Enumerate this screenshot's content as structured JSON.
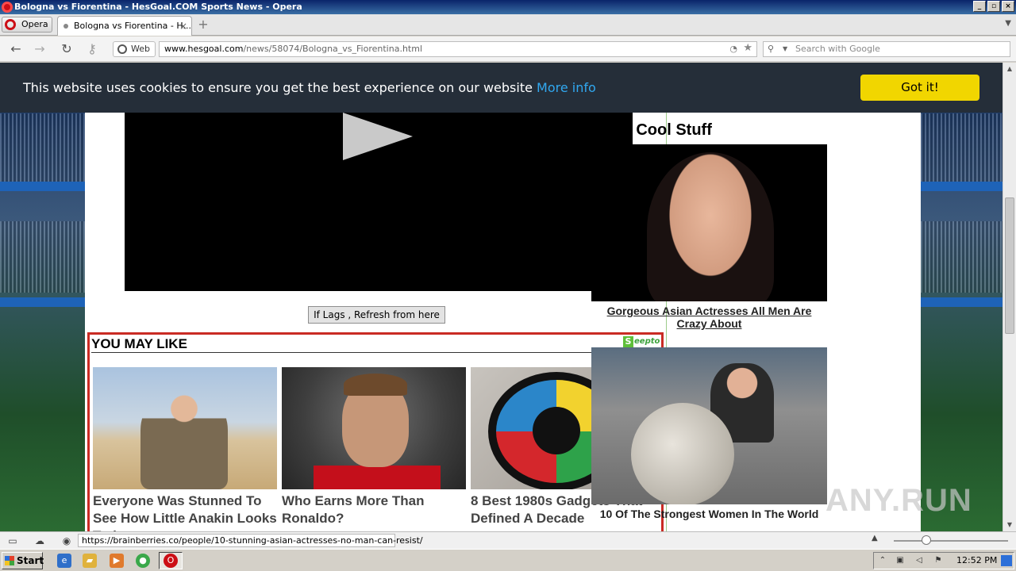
{
  "window": {
    "title": "Bologna vs Fiorentina - HesGoal.COM Sports News - Opera",
    "controls": [
      "_",
      "▫",
      "×"
    ]
  },
  "browser": {
    "menu_label": "Opera",
    "tab_title": "Bologna vs Fiorentina - H...",
    "web_label": "Web",
    "url_host": "www.hesgoal.com",
    "url_path": "/news/58074/Bologna_vs_Fiorentina.html",
    "search_placeholder": "Search with Google",
    "status_url": "https://brainberries.co/people/10-stunning-asian-actresses-no-man-can-resist/"
  },
  "cookie_banner": {
    "text": "This website uses cookies to ensure you get the best experience on our website",
    "more_info": "More info",
    "button": "Got it!"
  },
  "page": {
    "lag_button": "If Lags , Refresh from here",
    "you_may_like": {
      "title": "YOU MAY LIKE",
      "brand_letter": "S",
      "brand": "eepto",
      "items": [
        {
          "caption": "Everyone Was Stunned To See How Little Anakin Looks Today"
        },
        {
          "caption": "Who Earns More Than Ronaldo?"
        },
        {
          "caption": "8 Best 1980s Gadgets That Defined A Decade"
        }
      ]
    },
    "more_cool_stuff": {
      "title": "More Cool Stuff",
      "items": [
        {
          "caption": "Gorgeous Asian Actresses All Men Are Crazy About"
        },
        {
          "caption": "10 Of The Strongest Women In The World"
        }
      ]
    },
    "watermark": "ANY.RUN"
  },
  "taskbar": {
    "start_label": "Start",
    "clock": "12:52 PM"
  },
  "colors": {
    "cookie_bg": "#252e39",
    "cookie_link": "#31a8f0",
    "got_it": "#f1d600",
    "yml_border": "#c92b24"
  }
}
